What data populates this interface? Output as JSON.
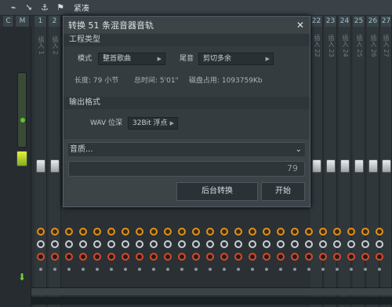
{
  "toolbar": {
    "icons": [
      "wave-icon",
      "arrow-in-icon",
      "anchor-icon",
      "flag-icon"
    ],
    "label": "紧凑"
  },
  "mixer": {
    "master_headers": [
      "C",
      "M"
    ],
    "channel_numbers": [
      "1",
      "2",
      "22",
      "23",
      "24",
      "25",
      "26",
      "27"
    ],
    "left_strip_names": [
      "插入 1",
      "插入 2"
    ],
    "right_strip_names": [
      "插入 22",
      "插入 23",
      "插入 24",
      "插入 25",
      "插入 26",
      "插入 27"
    ],
    "master_controls": [
      "◀",
      "●",
      "●",
      "■"
    ]
  },
  "dialog": {
    "title": "转换 51 条混音器音轨",
    "close": "✕",
    "section_project": "工程类型",
    "mode_label": "模式",
    "mode_value": "整首歌曲",
    "tail_label": "尾音",
    "tail_value": "剪切多余",
    "length": "长度: 79 小节",
    "total_time": "总时间: 5'01\"",
    "disk_usage": "磁盘占用: 1093759Kb",
    "section_output": "输出格式",
    "wav_label": "WAV 位深",
    "wav_value": "32Bit 浮点",
    "quality_label": "音质...",
    "progress_value": "79",
    "background_button": "后台转换",
    "start_button": "开始"
  }
}
